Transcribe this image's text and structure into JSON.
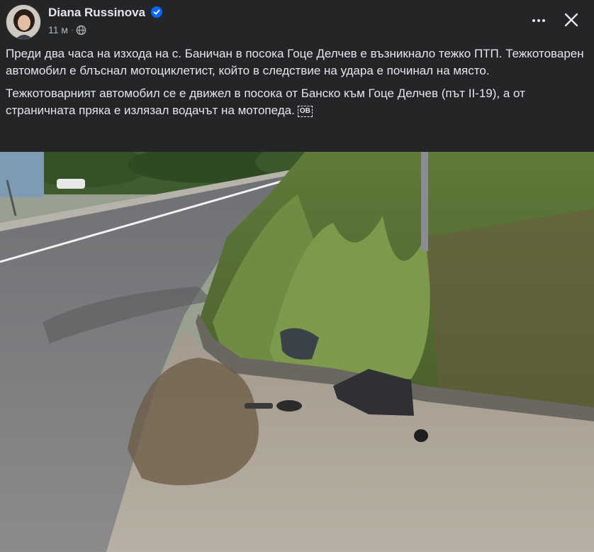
{
  "post": {
    "author": "Diana Russinova",
    "verified": true,
    "time": "11 м",
    "audience_icon": "globe-icon",
    "paragraphs": [
      "Преди два часа на изхода на с. Баничан в посока Гоце Делчев е възникнало тежко ПТП. Тежкотоварен автомобил е блъснал мотоциклетист, който в следствие на удара е починал на място.",
      "Тежкотоварният автомобил се е движел в посока от Банско към Гоце Делчев (път II-19), а от страничната пряка е излязал водачът на мотопеда."
    ],
    "badge": "ОВ"
  },
  "actions": {
    "more_icon": "more-horizontal-icon",
    "close_icon": "close-icon"
  },
  "colors": {
    "background": "#242526",
    "text_primary": "#e4e6eb",
    "text_secondary": "#b0b3b8",
    "verified_blue": "#0866ff"
  }
}
